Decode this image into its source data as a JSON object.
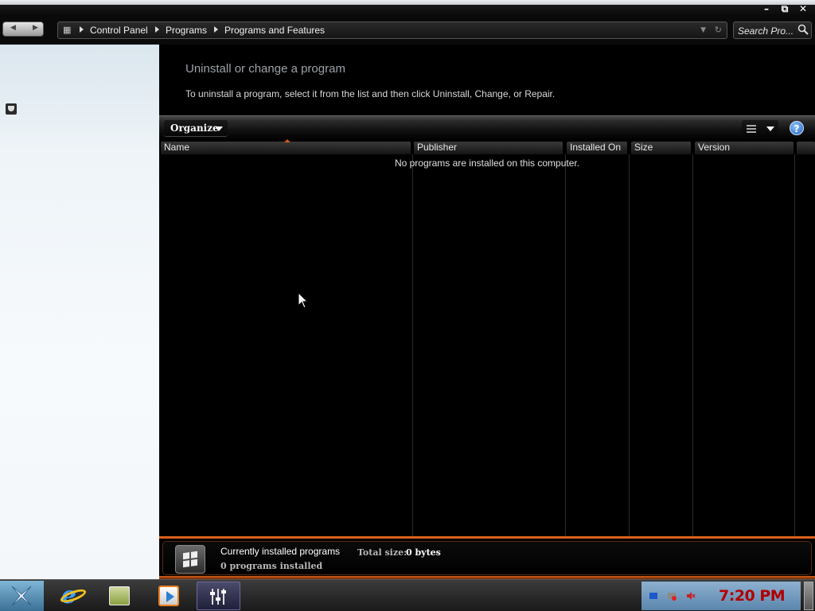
{
  "window": {
    "controls": {
      "minimize": "–",
      "maximize": "⧉",
      "close": "✕"
    }
  },
  "addressbar": {
    "breadcrumbs": [
      "Control Panel",
      "Programs",
      "Programs and Features"
    ],
    "search_placeholder": "Search Pro..."
  },
  "main": {
    "heading": "Uninstall or change a program",
    "subtext": "To uninstall a program, select it from the list and then click Uninstall, Change, or Repair.",
    "toolbar": {
      "organize_label": "Organize",
      "help_label": "?"
    },
    "columns": [
      "Name",
      "Publisher",
      "Installed On",
      "Size",
      "Version"
    ],
    "empty_message": "No programs are installed on this computer."
  },
  "details": {
    "title": "Currently installed programs",
    "total_size_label": "Total size:",
    "total_size_value": "0 bytes",
    "count_text": "0 programs installed"
  },
  "taskbar": {
    "items": [
      "start-icon",
      "internet-explorer-icon",
      "file-explorer-icon",
      "media-player-icon",
      "control-panel-icon"
    ],
    "clock": "7:20 PM"
  },
  "colors": {
    "accent": "#d9611c",
    "clock": "#b00000",
    "background": "#000000"
  }
}
